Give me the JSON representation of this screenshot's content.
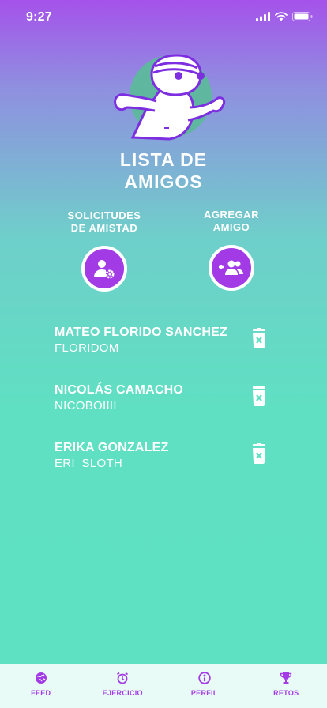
{
  "status_bar": {
    "time": "9:27"
  },
  "page": {
    "title_line1": "LISTA DE",
    "title_line2": "AMIGOS"
  },
  "actions": {
    "requests": {
      "line1": "SOLICITUDES",
      "line2": "DE AMISTAD",
      "icon": "user-settings-icon"
    },
    "add": {
      "line1": "AGREGAR",
      "line2": "AMIGO",
      "icon": "add-friend-icon"
    }
  },
  "friends": [
    {
      "name": "MATEO FLORIDO SANCHEZ",
      "username": "FLORIDOM"
    },
    {
      "name": "NICOLÁS CAMACHO",
      "username": "NICOBOIIII"
    },
    {
      "name": "ERIKA GONZALEZ",
      "username": "ERI_SLOTH"
    }
  ],
  "tabs": [
    {
      "label": "FEED",
      "icon": "globe-icon"
    },
    {
      "label": "EJERCICIO",
      "icon": "alarm-clock-icon"
    },
    {
      "label": "PERFIL",
      "icon": "profile-icon"
    },
    {
      "label": "RETOS",
      "icon": "trophy-icon"
    }
  ],
  "colors": {
    "accent": "#a23be6",
    "background_top": "#a552ea",
    "background_bottom": "#5ee1c2",
    "tab_bar": "#e9fbf6"
  }
}
